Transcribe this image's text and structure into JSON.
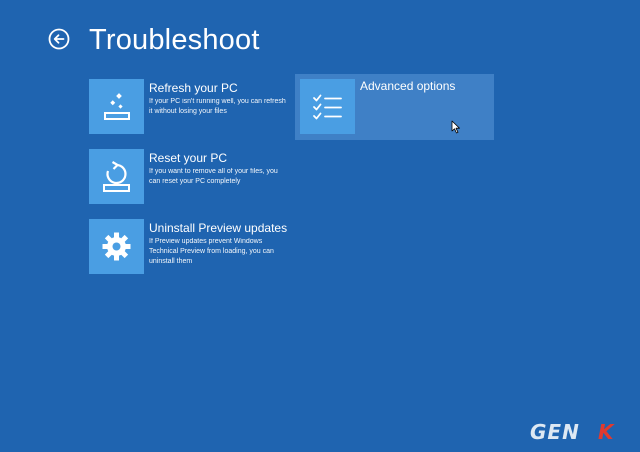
{
  "header": {
    "title": "Troubleshoot"
  },
  "tiles": [
    {
      "title": "Refresh your PC",
      "description": "If your PC isn't running well, you can refresh it without losing your files",
      "icon": "refresh-pc-icon"
    },
    {
      "title": "Reset your PC",
      "description": "If you want to remove all of your files, you can reset your PC completely",
      "icon": "reset-pc-icon"
    },
    {
      "title": "Uninstall Preview updates",
      "description": "If Preview updates prevent Windows Technical Preview from loading, you can uninstall them",
      "icon": "gear-icon"
    },
    {
      "title": "Advanced options",
      "description": "",
      "icon": "checklist-icon"
    }
  ],
  "watermark": {
    "text": "GENK"
  },
  "colors": {
    "background": "#1f64b0",
    "tile_icon_bg": "#4a9ee3",
    "selected_tile_bg": "#3f80c6"
  }
}
